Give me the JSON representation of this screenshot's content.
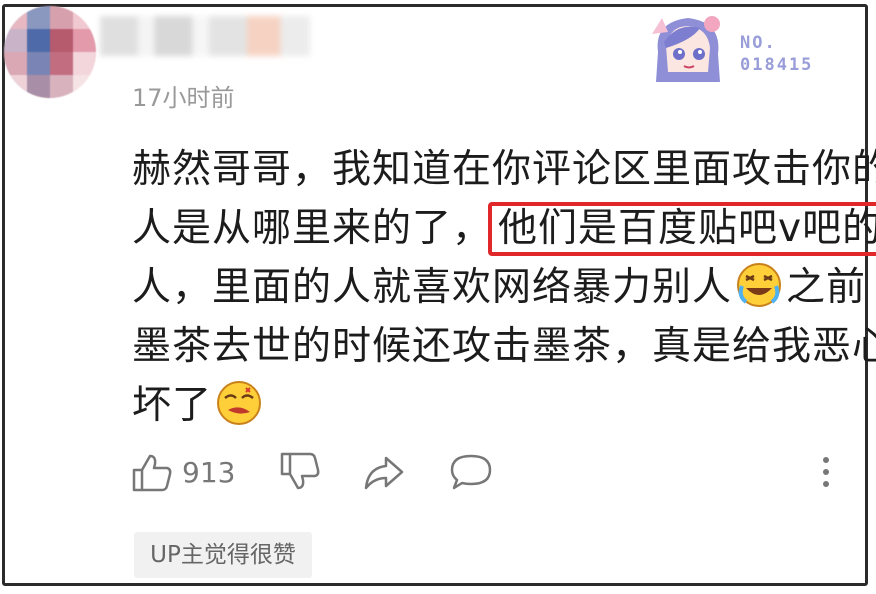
{
  "comment": {
    "timestamp": "17小时前",
    "badge": {
      "label_line1": "NO.",
      "label_line2": "018415",
      "art_icon": "anime-character-icon"
    },
    "text_lines": [
      "赫然哥哥，我知道在你评论区里面攻击你的",
      "人是从哪里来的了，",
      "人，里面的人就喜欢网络暴力别人",
      "之前",
      "墨茶去世的时候还攻击墨茶，真是给我恶心",
      "坏了"
    ],
    "highlighted_text": "他们是百度贴吧v吧的",
    "highlight_color": "#e0272a",
    "emojis": [
      "crying-face-emoji",
      "angry-face-emoji"
    ]
  },
  "actions": {
    "like_count": "913",
    "icons": [
      "thumbs-up-icon",
      "thumbs-down-icon",
      "share-icon",
      "reply-icon",
      "more-icon"
    ]
  },
  "up_tag": {
    "label": "UP主觉得很赞"
  }
}
